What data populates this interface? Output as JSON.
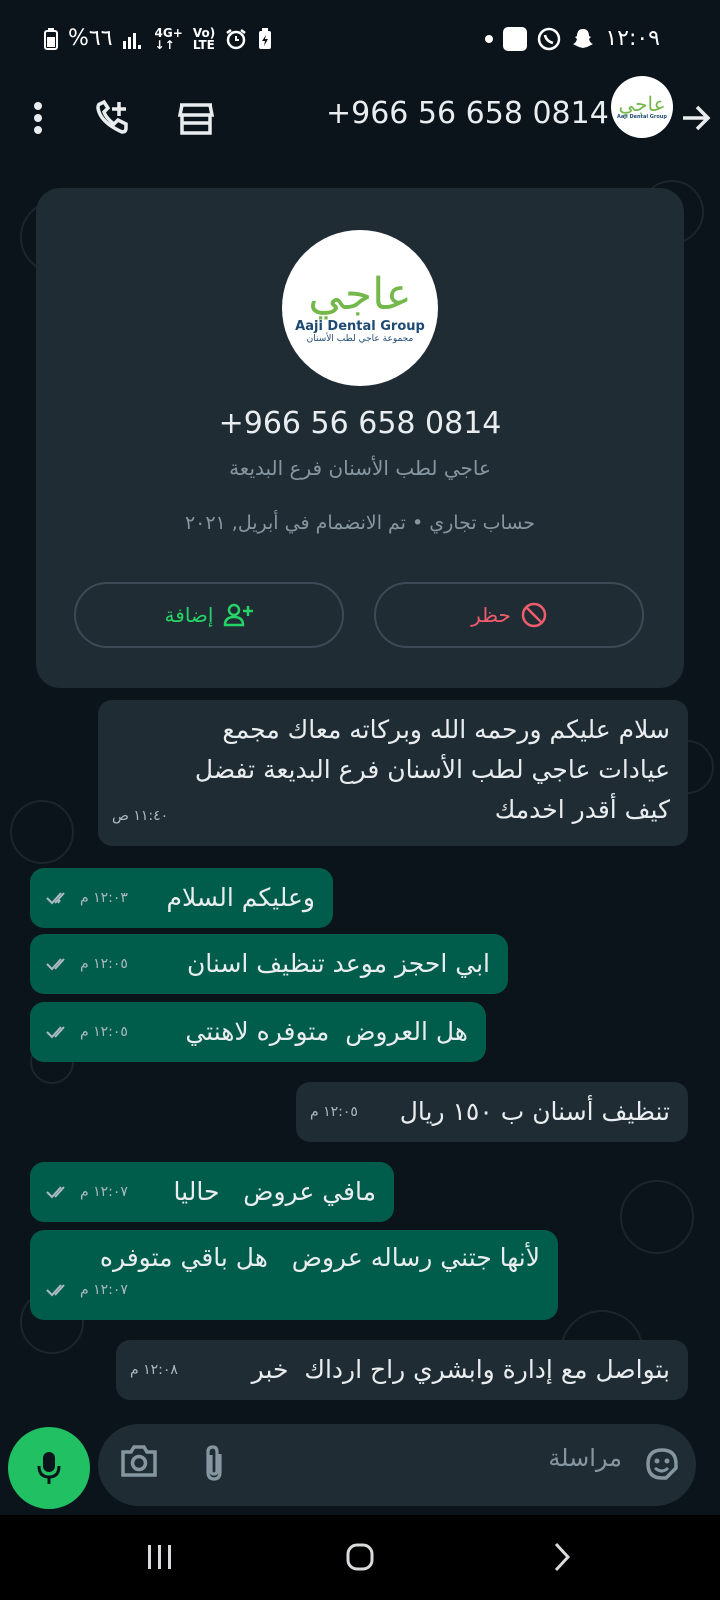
{
  "statusbar": {
    "battery": "%٦٦",
    "network_top": "4G+",
    "volte_top": "Vo)",
    "volte_bottom": "LTE",
    "time": "١٢:٠٩"
  },
  "header": {
    "phone_number": "+966 56 658 0814",
    "icons": [
      "more-vert-icon",
      "add-call-icon",
      "store-icon",
      "forward-arrow-icon"
    ]
  },
  "contact_card": {
    "logo_arabic": "عاجي",
    "logo_english": "Aaji Dental Group",
    "logo_subtitle": "مجموعة عاجي لطب الأسنان",
    "phone_number": "+966 56 658 0814",
    "business_name": "عاجي لطب الأسنان فرع البديعة",
    "info": "حساب تجاري • تم الانضمام في أبريل, ٢٠٢١",
    "add_label": "إضافة",
    "block_label": "حظر"
  },
  "messages": [
    {
      "direction": "in",
      "lines": [
        "سلام عليكم ورحمه الله وبركاته معاك مجمع",
        "عيادات عاجي لطب الأسنان فرع البديعة تفضل",
        "كيف أقدر اخدمك"
      ],
      "time": "١١:٤٠ ص"
    },
    {
      "direction": "out",
      "lines": [
        "وعليكم السلام"
      ],
      "time": "١٢:٠٣ م"
    },
    {
      "direction": "out",
      "lines": [
        "ابي احجز موعد تنظيف اسنان"
      ],
      "time": "١٢:٠٥ م"
    },
    {
      "direction": "out",
      "lines": [
        "هل العروض  متوفره لاهنتي"
      ],
      "time": "١٢:٠٥ م"
    },
    {
      "direction": "in",
      "lines": [
        "تنظيف أسنان ب ١٥٠ ريال"
      ],
      "time": "١٢:٠٥ م"
    },
    {
      "direction": "out",
      "lines": [
        "مافي عروض   حاليا"
      ],
      "time": "١٢:٠٧ م"
    },
    {
      "direction": "out",
      "lines": [
        "لأنها جتني رساله عروض   هل باقي متوفره"
      ],
      "time": "١٢:٠٧ م"
    },
    {
      "direction": "in",
      "lines": [
        "بتواصل مع إدارة وابشري راح ارداك  خبر"
      ],
      "time": "١٢:٠٨ م"
    }
  ],
  "composer": {
    "placeholder": "مراسلة"
  },
  "colors": {
    "background": "#0b141a",
    "incoming_bubble": "#1f2c33",
    "outgoing_bubble": "#005c4b",
    "accent_green": "#25d366",
    "block_red": "#f15c6d"
  }
}
